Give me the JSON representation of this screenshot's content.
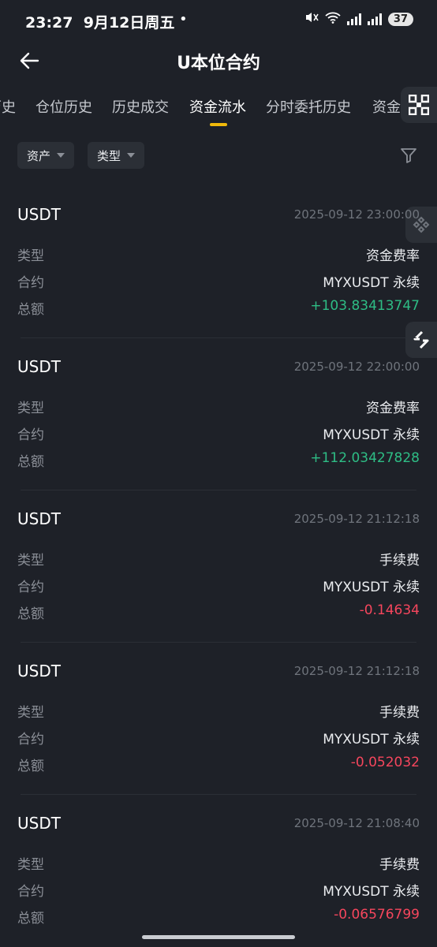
{
  "status_bar": {
    "time": "23:27",
    "date": "9月12日周五",
    "dot": "•",
    "battery": "37"
  },
  "header": {
    "title": "U本位合约"
  },
  "tabs": [
    {
      "label": "历史",
      "active": false
    },
    {
      "label": "仓位历史",
      "active": false
    },
    {
      "label": "历史成交",
      "active": false
    },
    {
      "label": "资金流水",
      "active": true
    },
    {
      "label": "分时委托历史",
      "active": false
    },
    {
      "label": "资金",
      "active": false
    }
  ],
  "filters": {
    "asset_label": "资产",
    "type_label": "类型"
  },
  "field_labels": {
    "type": "类型",
    "contract": "合约",
    "amount": "总额"
  },
  "records": [
    {
      "asset": "USDT",
      "time": "2025-09-12 23:00:00",
      "type": "资金费率",
      "contract": "MYXUSDT 永续",
      "amount": "+103.83413747",
      "sign": "positive"
    },
    {
      "asset": "USDT",
      "time": "2025-09-12 22:00:00",
      "type": "资金费率",
      "contract": "MYXUSDT 永续",
      "amount": "+112.03427828",
      "sign": "positive"
    },
    {
      "asset": "USDT",
      "time": "2025-09-12 21:12:18",
      "type": "手续费",
      "contract": "MYXUSDT 永续",
      "amount": "-0.14634",
      "sign": "negative"
    },
    {
      "asset": "USDT",
      "time": "2025-09-12 21:12:18",
      "type": "手续费",
      "contract": "MYXUSDT 永续",
      "amount": "-0.052032",
      "sign": "negative"
    },
    {
      "asset": "USDT",
      "time": "2025-09-12 21:08:40",
      "type": "手续费",
      "contract": "MYXUSDT 永续",
      "amount": "-0.06576799",
      "sign": "negative"
    }
  ],
  "colors": {
    "background": "#1e2128",
    "positive": "#2ebd85",
    "negative": "#f6465d",
    "accent": "#f0b90b"
  }
}
